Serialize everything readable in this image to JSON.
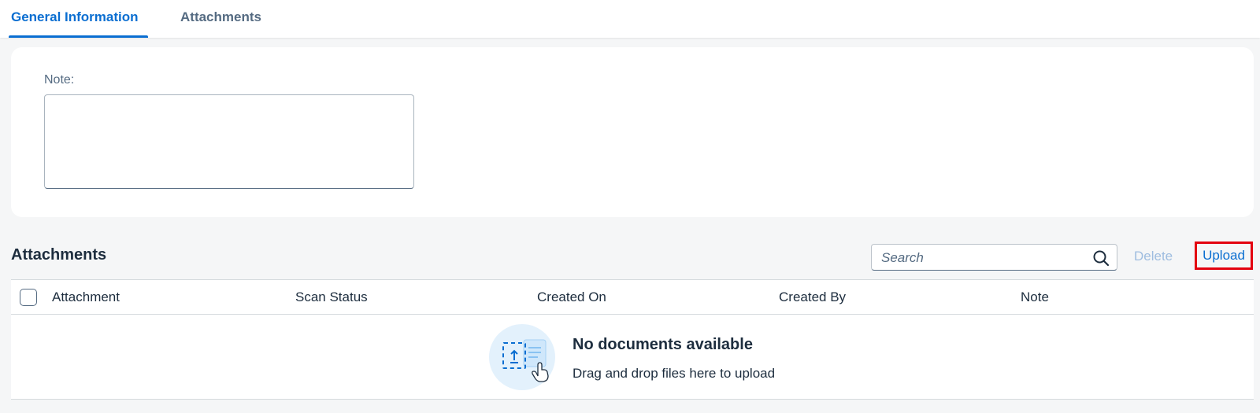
{
  "tabs": [
    {
      "label": "General Information",
      "active": true
    },
    {
      "label": "Attachments",
      "active": false
    }
  ],
  "note": {
    "label": "Note:",
    "value": ""
  },
  "attachments": {
    "title": "Attachments",
    "search_placeholder": "Search",
    "delete_label": "Delete",
    "upload_label": "Upload",
    "columns": [
      "Attachment",
      "Scan Status",
      "Created On",
      "Created By",
      "Note"
    ],
    "rows": [],
    "empty_title": "No documents available",
    "empty_subtitle": "Drag and drop files here to upload"
  },
  "colors": {
    "accent": "#0a6ed1",
    "highlight": "#e3000f",
    "disabled_text": "#9fbde0",
    "background": "#f5f6f7"
  }
}
